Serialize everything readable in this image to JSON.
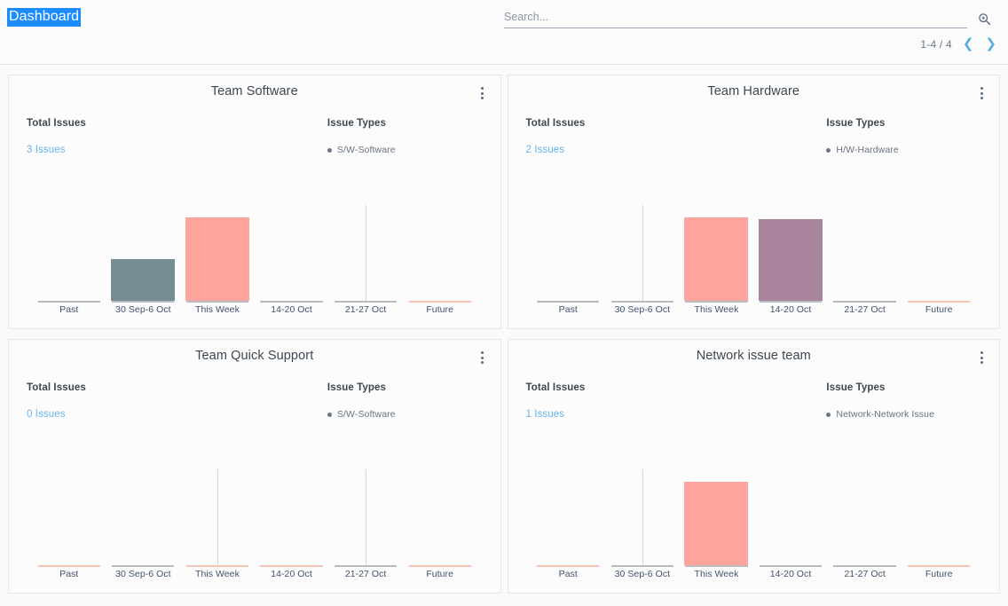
{
  "header": {
    "title": "Dashboard",
    "search": {
      "placeholder": "Search...",
      "value": "",
      "icon": "search-icon"
    },
    "pagination": {
      "label": "1-4 / 4",
      "prev_icon": "chevron-left-icon",
      "next_icon": "chevron-right-icon",
      "arrow_color": "#5aade0"
    },
    "title_highlight_color": "#1a8cff"
  },
  "labels": {
    "total_issues": "Total Issues",
    "issue_types": "Issue Types",
    "menu_icon": "kebab-menu-icon"
  },
  "colors": {
    "bar_salmon": "#ffa49c",
    "bar_slate": "#778d95",
    "bar_mauve": "#a8859d",
    "axis_gray": "#b6bcc2",
    "axis_peach": "#f7c3b5",
    "link_blue": "#64b5f0",
    "gridline": "#d8d8d8"
  },
  "cards": [
    {
      "title": "Team Software",
      "total_issues_value": "3 Issues",
      "issue_type": "S/W-Software",
      "chart_data": {
        "type": "bar",
        "title": "Team Software",
        "categories": [
          "Past",
          "30 Sep-6 Oct",
          "This Week",
          "14-20 Oct",
          "21-27 Oct",
          "Future"
        ],
        "values": [
          0,
          1,
          2,
          0,
          0,
          0
        ],
        "bar_colors": [
          null,
          "#778d95",
          "#ffa49c",
          null,
          null,
          null
        ],
        "axis_segment_colors": [
          "#b6bcc2",
          "#b6bcc2",
          "#b6bcc2",
          "#b6bcc2",
          "#b6bcc2",
          "#f7c3b5"
        ],
        "gridlines_at": [
          "21-27 Oct"
        ],
        "xlabel": "",
        "ylabel": "",
        "ylim": [
          0,
          2.3
        ],
        "grid": false,
        "legend": [
          "S/W-Software"
        ]
      }
    },
    {
      "title": "Team Hardware",
      "total_issues_value": "2 Issues",
      "issue_type": "H/W-Hardware",
      "chart_data": {
        "type": "bar",
        "title": "Team Hardware",
        "categories": [
          "Past",
          "30 Sep-6 Oct",
          "This Week",
          "14-20 Oct",
          "21-27 Oct",
          "Future"
        ],
        "values": [
          0,
          0,
          2,
          1.95,
          0,
          0
        ],
        "bar_colors": [
          null,
          null,
          "#ffa49c",
          "#a8859d",
          null,
          null
        ],
        "axis_segment_colors": [
          "#b6bcc2",
          "#b6bcc2",
          "#b6bcc2",
          "#b6bcc2",
          "#b6bcc2",
          "#f7c3b5"
        ],
        "gridlines_at": [
          "30 Sep-6 Oct"
        ],
        "xlabel": "",
        "ylabel": "",
        "ylim": [
          0,
          2.3
        ],
        "grid": false,
        "legend": [
          "H/W-Hardware"
        ]
      }
    },
    {
      "title": "Team Quick Support",
      "total_issues_value": "0 Issues",
      "issue_type": "S/W-Software",
      "chart_data": {
        "type": "bar",
        "title": "Team Quick Support",
        "categories": [
          "Past",
          "30 Sep-6 Oct",
          "This Week",
          "14-20 Oct",
          "21-27 Oct",
          "Future"
        ],
        "values": [
          0,
          0,
          0,
          0,
          0,
          0
        ],
        "bar_colors": [
          null,
          null,
          null,
          null,
          null,
          null
        ],
        "axis_segment_colors": [
          "#f7c3b5",
          "#b6bcc2",
          "#f7c3b5",
          "#f7c3b5",
          "#b6bcc2",
          "#f7c3b5"
        ],
        "gridlines_at": [
          "This Week",
          "21-27 Oct"
        ],
        "xlabel": "",
        "ylabel": "",
        "ylim": [
          0,
          2.3
        ],
        "grid": false,
        "legend": [
          "S/W-Software"
        ]
      }
    },
    {
      "title": "Network issue team",
      "total_issues_value": "1 Issues",
      "issue_type": "Network-Network Issue",
      "chart_data": {
        "type": "bar",
        "title": "Network issue team",
        "categories": [
          "Past",
          "30 Sep-6 Oct",
          "This Week",
          "14-20 Oct",
          "21-27 Oct",
          "Future"
        ],
        "values": [
          0,
          0,
          2,
          0,
          0,
          0
        ],
        "bar_colors": [
          null,
          null,
          "#ffa49c",
          null,
          null,
          null
        ],
        "axis_segment_colors": [
          "#f7c3b5",
          "#b6bcc2",
          "#b6bcc2",
          "#b6bcc2",
          "#b6bcc2",
          "#f7c3b5"
        ],
        "gridlines_at": [
          "30 Sep-6 Oct"
        ],
        "xlabel": "",
        "ylabel": "",
        "ylim": [
          0,
          2.3
        ],
        "grid": false,
        "legend": [
          "Network-Network Issue"
        ]
      }
    }
  ]
}
